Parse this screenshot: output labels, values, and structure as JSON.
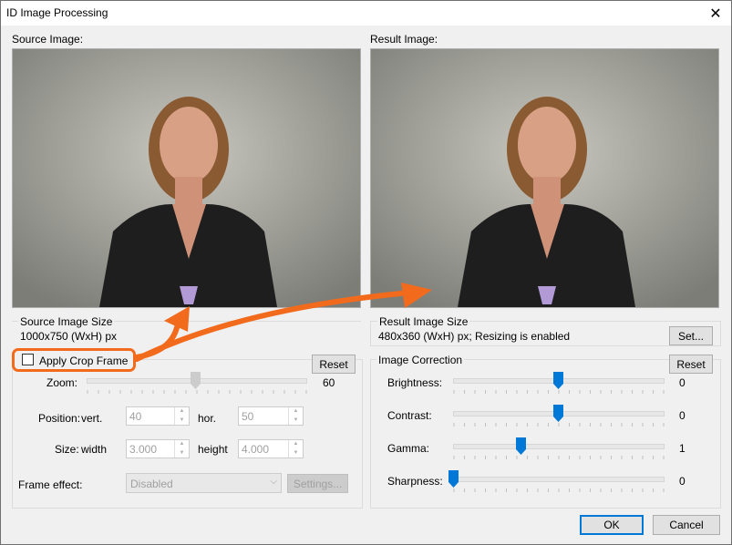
{
  "window": {
    "title": "ID Image Processing"
  },
  "source": {
    "label": "Source Image:",
    "size_group": "Source Image Size",
    "size_value": "1000x750 (WxH) px"
  },
  "result": {
    "label": "Result Image:",
    "size_group": "Result Image Size",
    "size_value": "480x360 (WxH) px; Resizing is enabled",
    "set_label": "Set..."
  },
  "crop": {
    "checkbox_label": "Apply Crop Frame",
    "checked": false,
    "reset_label": "Reset",
    "zoom_label": "Zoom:",
    "zoom_value": "60",
    "position_label": "Position:",
    "vert_label": "vert.",
    "vert_value": "40",
    "hor_label": "hor.",
    "hor_value": "50",
    "size_label": "Size:",
    "width_label": "width",
    "width_value": "3.000",
    "height_label": "height",
    "height_value": "4.000",
    "frame_effect_label": "Frame effect:",
    "frame_effect_value": "Disabled",
    "settings_label": "Settings..."
  },
  "correction": {
    "group_label": "Image Correction",
    "reset_label": "Reset",
    "sliders": [
      {
        "label": "Brightness:",
        "value": "0",
        "level": 0.5
      },
      {
        "label": "Contrast:",
        "value": "0",
        "level": 0.5
      },
      {
        "label": "Gamma:",
        "value": "1",
        "level": 0.32
      },
      {
        "label": "Sharpness:",
        "value": "0",
        "level": 0.0
      }
    ]
  },
  "buttons": {
    "ok": "OK",
    "cancel": "Cancel"
  },
  "colors": {
    "accent": "#0078d7",
    "annotation": "#f26a1b"
  }
}
